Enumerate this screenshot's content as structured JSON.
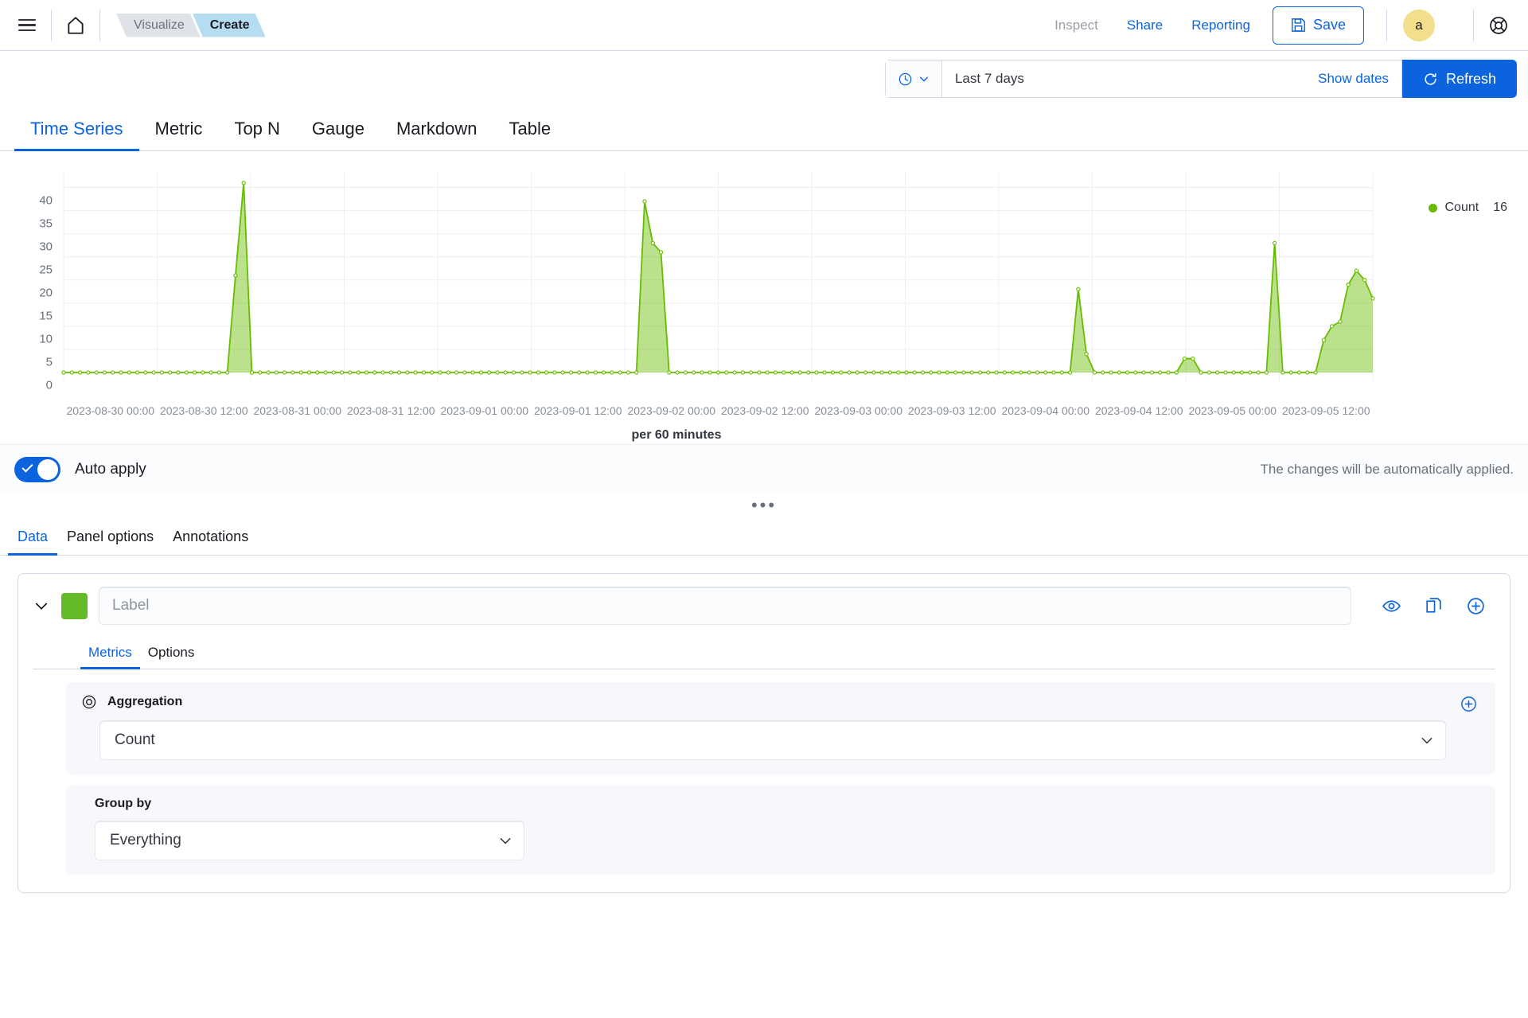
{
  "header": {
    "menu_icon": "hamburger-menu-icon",
    "home_icon": "home-icon",
    "breadcrumbs": [
      {
        "label": "Visualize",
        "active": false
      },
      {
        "label": "Create",
        "active": true
      }
    ],
    "inspect_label": "Inspect",
    "share_label": "Share",
    "reporting_label": "Reporting",
    "save_label": "Save",
    "save_icon": "floppy-disk-save-icon",
    "avatar_initial": "a",
    "help_icon": "help-lifebuoy-icon"
  },
  "datepicker": {
    "clock_icon": "clock-icon",
    "chevron_icon": "chevron-down-icon",
    "range_label": "Last 7 days",
    "show_dates_label": "Show dates",
    "refresh_label": "Refresh",
    "refresh_icon": "refresh-icon"
  },
  "viz_tabs": [
    {
      "label": "Time Series",
      "selected": true
    },
    {
      "label": "Metric",
      "selected": false
    },
    {
      "label": "Top N",
      "selected": false
    },
    {
      "label": "Gauge",
      "selected": false
    },
    {
      "label": "Markdown",
      "selected": false
    },
    {
      "label": "Table",
      "selected": false
    }
  ],
  "chart_data": {
    "type": "area",
    "title": "",
    "subtitle": "",
    "xlabel": "per 60 minutes",
    "ylabel": "",
    "ylim": [
      0,
      42
    ],
    "yticks": [
      0,
      5,
      10,
      15,
      20,
      25,
      30,
      35,
      40
    ],
    "grid": true,
    "legend_position": "top-right",
    "legend": [
      {
        "name": "Count",
        "value": "16",
        "color": "#68bc00"
      }
    ],
    "xtick_labels": [
      "2023-08-30 00:00",
      "2023-08-30 12:00",
      "2023-08-31 00:00",
      "2023-08-31 12:00",
      "2023-09-01 00:00",
      "2023-09-01 12:00",
      "2023-09-02 00:00",
      "2023-09-02 12:00",
      "2023-09-03 00:00",
      "2023-09-03 12:00",
      "2023-09-04 00:00",
      "2023-09-04 12:00",
      "2023-09-05 00:00",
      "2023-09-05 12:00"
    ],
    "x_start": "2023-08-30 00:00",
    "x_end": "2023-09-05 16:00",
    "interval_minutes": 60,
    "series": [
      {
        "name": "Count",
        "color": "#68bc00",
        "fill_color": "rgba(104,188,0,0.45)",
        "values": [
          0,
          0,
          0,
          0,
          0,
          0,
          0,
          0,
          0,
          0,
          0,
          0,
          0,
          0,
          0,
          0,
          0,
          0,
          0,
          0,
          0,
          21,
          41,
          0,
          0,
          0,
          0,
          0,
          0,
          0,
          0,
          0,
          0,
          0,
          0,
          0,
          0,
          0,
          0,
          0,
          0,
          0,
          0,
          0,
          0,
          0,
          0,
          0,
          0,
          0,
          0,
          0,
          0,
          0,
          0,
          0,
          0,
          0,
          0,
          0,
          0,
          0,
          0,
          0,
          0,
          0,
          0,
          0,
          0,
          0,
          0,
          37,
          28,
          26,
          0,
          0,
          0,
          0,
          0,
          0,
          0,
          0,
          0,
          0,
          0,
          0,
          0,
          0,
          0,
          0,
          0,
          0,
          0,
          0,
          0,
          0,
          0,
          0,
          0,
          0,
          0,
          0,
          0,
          0,
          0,
          0,
          0,
          0,
          0,
          0,
          0,
          0,
          0,
          0,
          0,
          0,
          0,
          0,
          0,
          0,
          0,
          0,
          0,
          0,
          18,
          4,
          0,
          0,
          0,
          0,
          0,
          0,
          0,
          0,
          0,
          0,
          0,
          3,
          3,
          0,
          0,
          0,
          0,
          0,
          0,
          0,
          0,
          0,
          28,
          0,
          0,
          0,
          0,
          0,
          7,
          10,
          11,
          19,
          22,
          20,
          16
        ]
      }
    ],
    "peaks": [
      {
        "time": "2023-08-30 21:00",
        "value": 21
      },
      {
        "time": "2023-08-30 22:00",
        "value": 41
      },
      {
        "time": "2023-09-01 23:00",
        "value": 37
      },
      {
        "time": "2023-09-02 00:00",
        "value": 28
      },
      {
        "time": "2023-09-02 01:00",
        "value": 26
      },
      {
        "time": "2023-09-04 04:00",
        "value": 18
      },
      {
        "time": "2023-09-04 17:00",
        "value": 3
      },
      {
        "time": "2023-09-05 08:00",
        "value": 28
      },
      {
        "time": "2023-09-05 14:00",
        "value": 22
      },
      {
        "time": "2023-09-05 16:00",
        "value": 16
      }
    ]
  },
  "auto_apply": {
    "label": "Auto apply",
    "enabled": true,
    "note": "The changes will be automatically applied."
  },
  "collapse_handle": "•••",
  "data_tabs": [
    {
      "label": "Data",
      "selected": true
    },
    {
      "label": "Panel options",
      "selected": false
    },
    {
      "label": "Annotations",
      "selected": false
    }
  ],
  "series_panel": {
    "collapse_icon": "chevron-down-icon",
    "color_swatch": "#64bb27",
    "label_placeholder": "Label",
    "label_value": "",
    "actions": [
      {
        "name": "toggle-visibility-icon",
        "title": "eye"
      },
      {
        "name": "clone-series-icon",
        "title": "copy"
      },
      {
        "name": "add-series-icon",
        "title": "plus-in-circle"
      }
    ],
    "sub_tabs": [
      {
        "label": "Metrics",
        "selected": true
      },
      {
        "label": "Options",
        "selected": false
      }
    ],
    "aggregation": {
      "eye_icon": "aggregation-eye-icon",
      "title": "Aggregation",
      "value": "Count",
      "add_icon": "add-metric-icon",
      "chevron_icon": "chevron-down-icon"
    },
    "group_by": {
      "title": "Group by",
      "value": "Everything",
      "chevron_icon": "chevron-down-icon"
    }
  }
}
